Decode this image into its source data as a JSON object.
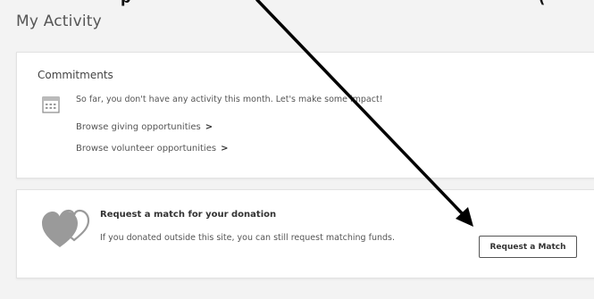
{
  "top_clip": {
    "fragment_1": "p",
    "fragment_2": "("
  },
  "page": {
    "title": "My Activity"
  },
  "commitments": {
    "title": "Commitments",
    "empty_message": "So far, you don't have any activity this month. Let's make some impact!",
    "browse_giving": "Browse giving opportunities",
    "browse_volunteer": "Browse volunteer opportunities",
    "chevron": ">"
  },
  "match": {
    "title": "Request a match for your donation",
    "description": "If you donated outside this site, you can still request matching funds.",
    "button_label": "Request a Match"
  },
  "icons": {
    "calendar": "calendar-icon",
    "hearts": "hearts-icon",
    "arrow": "annotation-arrow"
  },
  "colors": {
    "background": "#f3f3f3",
    "card": "#ffffff",
    "heart": "#9a9a9a",
    "arrow": "#000000"
  }
}
